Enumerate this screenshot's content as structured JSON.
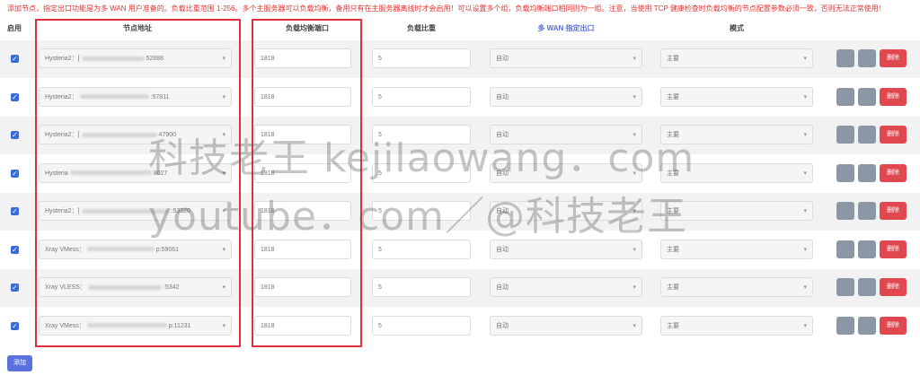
{
  "notice": "添加节点，指定出口功能是为多 WAN 用户准备的。负载比重范围 1-256。多个主服务器可以负载均衡，备用只有在主服务器离线时才会启用！可以设置多个组，负载均衡端口相同则为一组。注意，当使用 TCP 健康检查时负载均衡的节点配置参数必须一致，否则无法正常使用！",
  "headers": {
    "enable": "启用",
    "node": "节点地址",
    "port": "负载均衡端口",
    "weight": "负载比重",
    "wan": "多 WAN 指定出口",
    "mode": "模式"
  },
  "rows": [
    {
      "node_prefix": "Hysteria2：[",
      "node_suffix": "52888",
      "port": "1818",
      "weight": "5",
      "wan": "自动",
      "mode": "主要",
      "delete": "删除"
    },
    {
      "node_prefix": "Hysteria2：",
      "node_suffix": ":57811",
      "port": "1818",
      "weight": "5",
      "wan": "自动",
      "mode": "主要",
      "delete": "删除"
    },
    {
      "node_prefix": "Hysteria2：[",
      "node_suffix": "47900",
      "port": "1818",
      "weight": "5",
      "wan": "自动",
      "mode": "主要",
      "delete": "删除"
    },
    {
      "node_prefix": "Hysteria",
      "node_suffix": "8027",
      "port": "1818",
      "weight": "5",
      "wan": "自动",
      "mode": "主要",
      "delete": "删除"
    },
    {
      "node_prefix": "Hysteria2：[",
      "node_suffix": ":53320",
      "port": "1818",
      "weight": "5",
      "wan": "自动",
      "mode": "主要",
      "delete": "删除"
    },
    {
      "node_prefix": "Xray VMess：",
      "node_suffix": "p:59061",
      "port": "1818",
      "weight": "5",
      "wan": "自动",
      "mode": "主要",
      "delete": "删除"
    },
    {
      "node_prefix": "Xray VLESS：",
      "node_suffix": ":5342",
      "port": "1818",
      "weight": "5",
      "wan": "自动",
      "mode": "主要",
      "delete": "删除"
    },
    {
      "node_prefix": "Xray VMess：",
      "node_suffix": "p:11231",
      "port": "1818",
      "weight": "5",
      "wan": "自动",
      "mode": "主要",
      "delete": "删除"
    }
  ],
  "add_button": "添加",
  "watermark": {
    "line1": "科技老王 kejilaowang．com",
    "line2": "youtube．com／@科技老王"
  },
  "colors": {
    "notice": "#e03434",
    "checkbox": "#3a6bd6",
    "delete": "#e0474f",
    "add": "#5a72e0",
    "highlight_box": "#e0303a"
  },
  "icons": {
    "checkbox": "check-icon",
    "dropdown": "chevron-down-icon"
  }
}
